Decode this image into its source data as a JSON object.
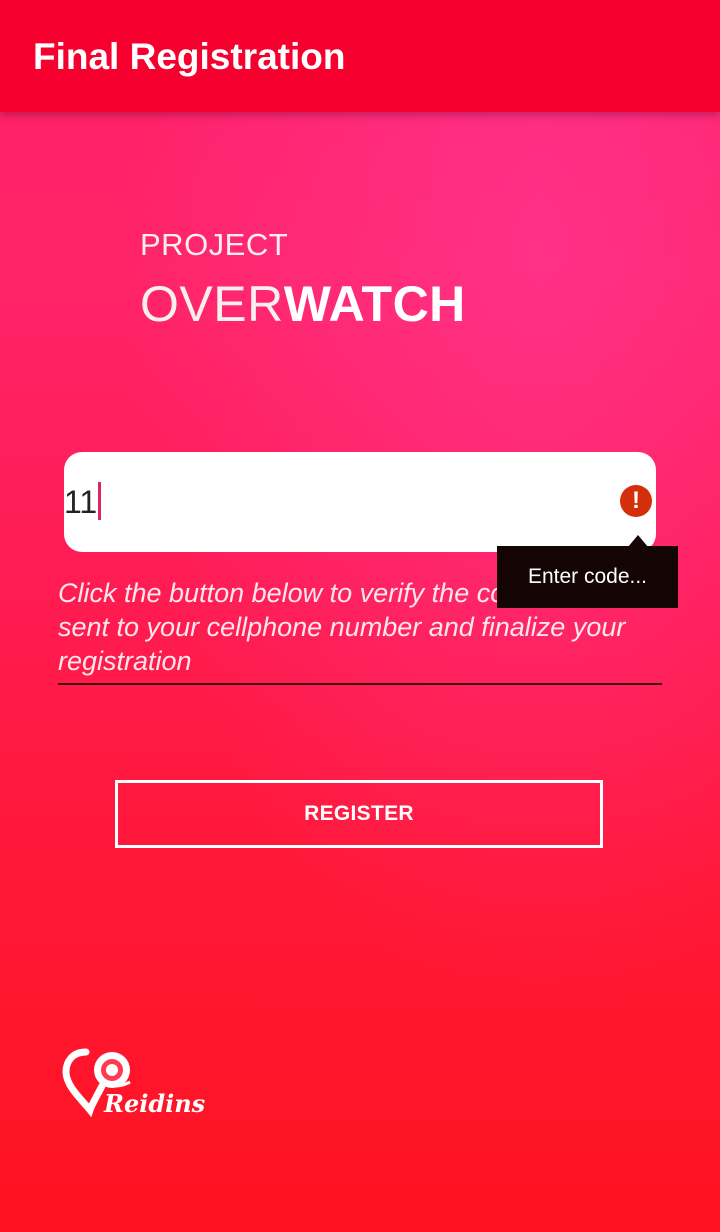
{
  "app_bar": {
    "title": "Final Registration"
  },
  "logo": {
    "line1": "PROJECT",
    "line2_light": "OVER",
    "line2_bold": "WATCH"
  },
  "code_field": {
    "value": "11",
    "error_icon": "error-exclamation-icon",
    "error_message": "Enter code..."
  },
  "instructions": "Click the button below to verify the code that was sent to your cellphone number and finalize your registration",
  "register_button": {
    "label": "REGISTER"
  },
  "brand": {
    "wordmark": "Reidins",
    "icon": "location-pin-icon"
  },
  "colors": {
    "app_bar": "#f6002f",
    "background_top": "#ff1f6a",
    "background_bottom": "#ff1220",
    "error_badge": "#d32f0a",
    "error_popup": "#140404"
  }
}
